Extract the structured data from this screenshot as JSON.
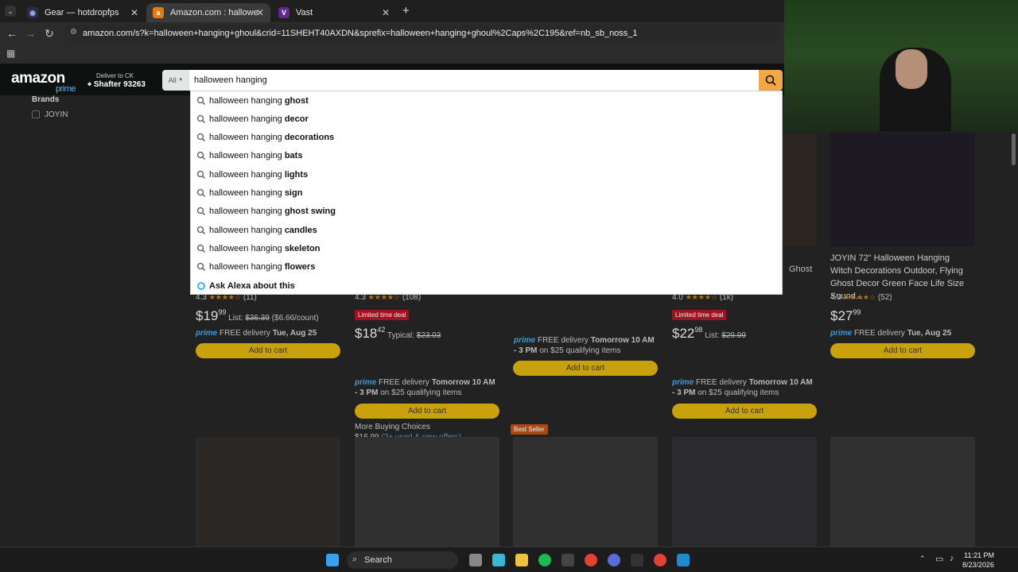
{
  "browser": {
    "tabs": [
      {
        "title": "Gear — hotdropfps",
        "active": false
      },
      {
        "title": "Amazon.com : halloween hang",
        "active": true
      },
      {
        "title": "Vast",
        "active": false
      }
    ],
    "url": "amazon.com/s?k=halloween+hanging+ghoul&crid=11SHEHT40AXDN&sprefix=halloween+hanging+ghoul%2Caps%2C195&ref=nb_sb_noss_1"
  },
  "amazon": {
    "logo": "amazon",
    "logo_sub": "prime",
    "deliver_line1": "Deliver to CK",
    "deliver_line2": "Shafter 93263",
    "search_category": "All",
    "search_value": "halloween hanging",
    "suggestions": [
      {
        "prefix": "halloween hanging ",
        "bold": "ghost"
      },
      {
        "prefix": "halloween hanging ",
        "bold": "decor"
      },
      {
        "prefix": "halloween hanging ",
        "bold": "decorations"
      },
      {
        "prefix": "halloween hanging ",
        "bold": "bats"
      },
      {
        "prefix": "halloween hanging ",
        "bold": "lights"
      },
      {
        "prefix": "halloween hanging ",
        "bold": "sign"
      },
      {
        "prefix": "halloween hanging ",
        "bold": "ghost swing"
      },
      {
        "prefix": "halloween hanging ",
        "bold": "candles"
      },
      {
        "prefix": "halloween hanging ",
        "bold": "skeleton"
      },
      {
        "prefix": "halloween hanging ",
        "bold": "flowers"
      }
    ],
    "ask_alexa": "Ask Alexa about this",
    "sidebar": {
      "heading": "Brands",
      "brand": "JOYIN"
    },
    "products": {
      "p1": {
        "rating": "4.3",
        "count": "(11)",
        "price_whole": "19",
        "price_frac": "99",
        "list": "List: ",
        "list_price": "$36.39",
        "per": " ($6.66/count)",
        "delivery": "FREE delivery ",
        "date": "Tue, Aug 25",
        "cart": "Add to cart"
      },
      "p2": {
        "rating": "4.3",
        "count": "(108)",
        "deal": "Limited time deal",
        "price_whole": "18",
        "price_frac": "42",
        "typical": "Typical: ",
        "typical_price": "$23.03",
        "delivery": "FREE delivery ",
        "date": "Tomorrow 10 AM - 3 PM",
        "qual": " on $25 qualifying items",
        "cart": "Add to cart",
        "more": "More Buying Choices",
        "more_price": "$16.99",
        "more_offers": " (2+ used & new offers)"
      },
      "p3": {
        "delivery": "FREE delivery ",
        "date": "Tomorrow 10 AM - 3 PM",
        "qual": " on $25 qualifying items",
        "cart": "Add to cart",
        "badge": "Best Seller"
      },
      "p4": {
        "title_tail": "Ghost",
        "rating": "4.0",
        "count": "(1k)",
        "deal": "Limited time deal",
        "price_whole": "22",
        "price_frac": "98",
        "list": "List: ",
        "list_price": "$29.99",
        "delivery": "FREE delivery ",
        "date": "Tomorrow 10 AM - 3 PM",
        "qual": " on $25 qualifying items",
        "cart": "Add to cart"
      },
      "p5": {
        "title": "JOYIN 72\" Halloween Hanging Witch Decorations Outdoor, Flying Ghost Decor Green Face Life Size Sound...",
        "rating": "4.3",
        "count": "(52)",
        "price_whole": "27",
        "price_frac": "99",
        "delivery": "FREE delivery ",
        "date": "Tue, Aug 25",
        "cart": "Add to cart"
      }
    },
    "prime_label": "prime"
  },
  "taskbar": {
    "search": "Search",
    "time": "11:21 PM",
    "date": "8/23/2026"
  },
  "colors": {
    "amazon_dark": "#0f1111",
    "search_btn": "#f3a847",
    "prime_blue": "#3a9ad9",
    "deal_red": "#a3101f"
  }
}
